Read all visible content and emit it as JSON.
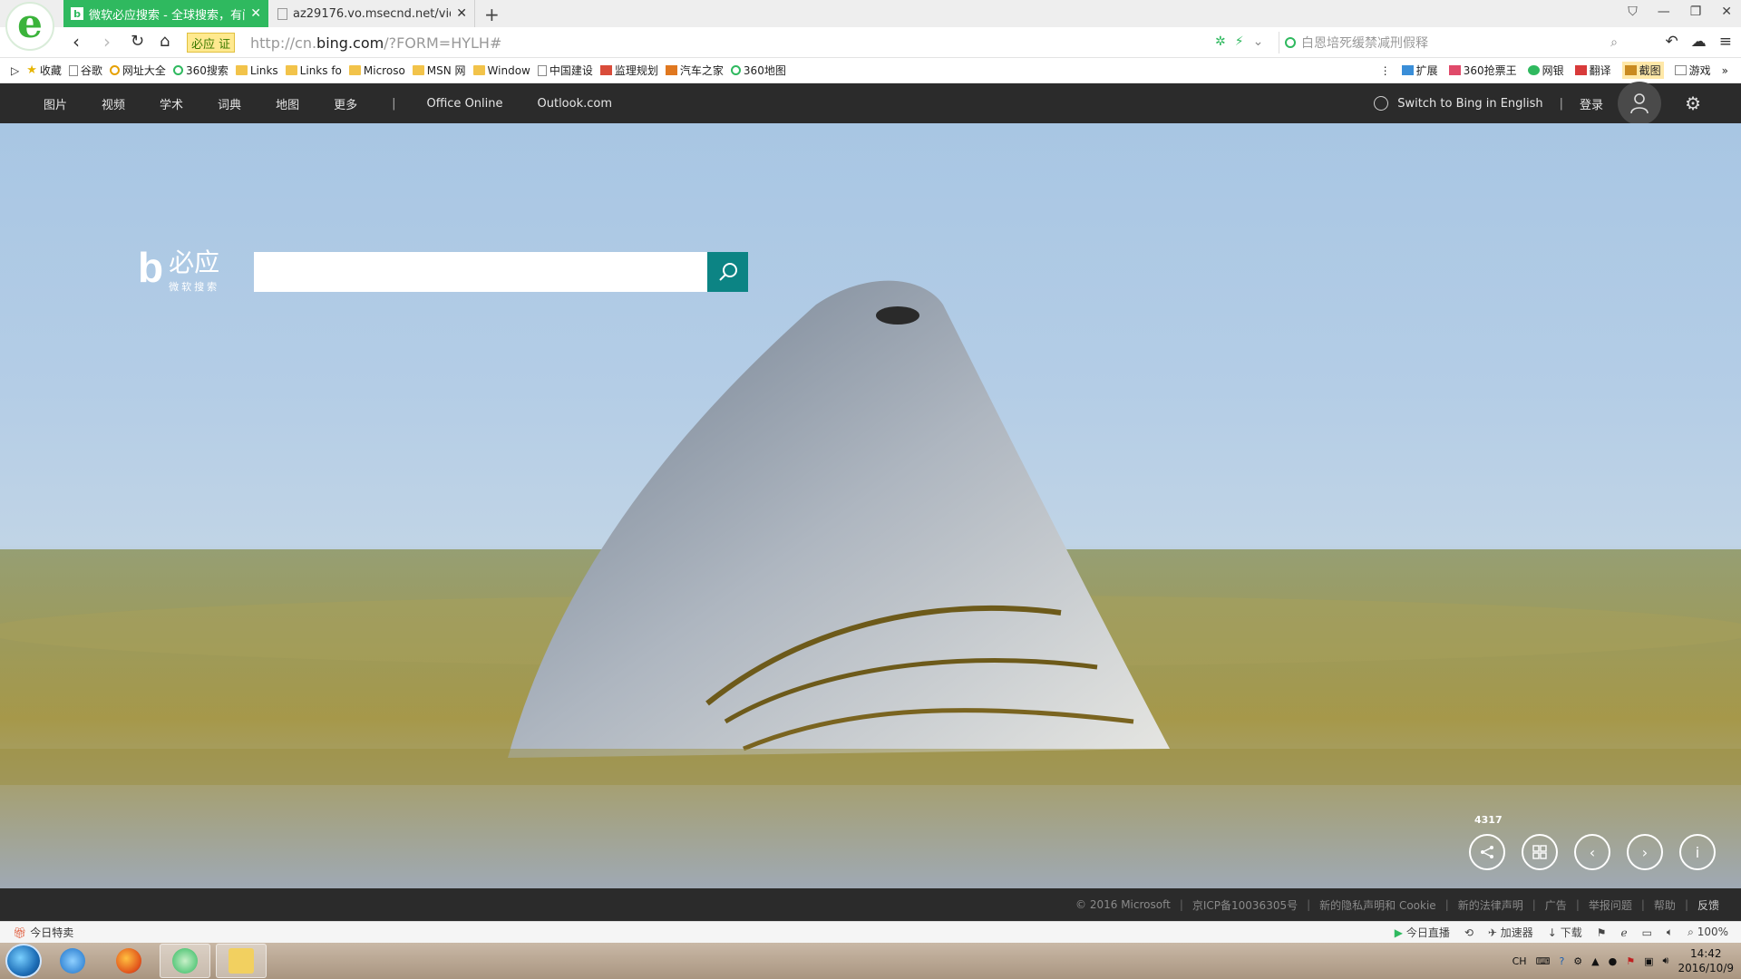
{
  "tabs": [
    {
      "title": "微软必应搜索 - 全球搜索，有问...",
      "close": "✕"
    },
    {
      "title": "az29176.vo.msecnd.net/video...",
      "close": "✕"
    }
  ],
  "new_tab": "+",
  "address": {
    "cert_label": "必应 证",
    "url_prefix": "http://cn.",
    "url_domain": "bing.com",
    "url_suffix": "/?FORM=HYLH#",
    "search_placeholder": "白恩培死缓禁减刑假释"
  },
  "bookmarks": {
    "left": [
      "收藏",
      "谷歌",
      "网址大全",
      "360搜索",
      "Links",
      "Links fo",
      "Microso",
      "MSN 网",
      "Window",
      "中国建设",
      "监理规划",
      "汽车之家",
      "360地图"
    ],
    "right": [
      "扩展",
      "360抢票王",
      "网银",
      "翻译",
      "截图",
      "游戏"
    ]
  },
  "bing_nav": {
    "items": [
      "图片",
      "视频",
      "学术",
      "词典",
      "地图",
      "更多"
    ],
    "separator": "|",
    "extra": [
      "Office Online",
      "Outlook.com"
    ],
    "switch_lang": "Switch to Bing in English",
    "login": "登录"
  },
  "logo": {
    "mark": "b",
    "main": "必应",
    "sub": "微软搜索"
  },
  "search": {
    "value": ""
  },
  "hero": {
    "count": "4317"
  },
  "footer": [
    "© 2016 Microsoft",
    "京ICP备10036305号",
    "新的隐私声明和 Cookie",
    "新的法律声明",
    "广告",
    "举报问题",
    "帮助",
    "反馈"
  ],
  "status": {
    "left": "今日特卖",
    "right": [
      "今日直播",
      "加速器",
      "下载",
      "100%"
    ]
  },
  "tray": {
    "lang": "CH",
    "time": "14:42",
    "date": "2016/10/9"
  },
  "colors": {
    "tab_active": "#2fb95f",
    "bing_bar": "#2b2b2b",
    "search_button": "#0c8484"
  }
}
